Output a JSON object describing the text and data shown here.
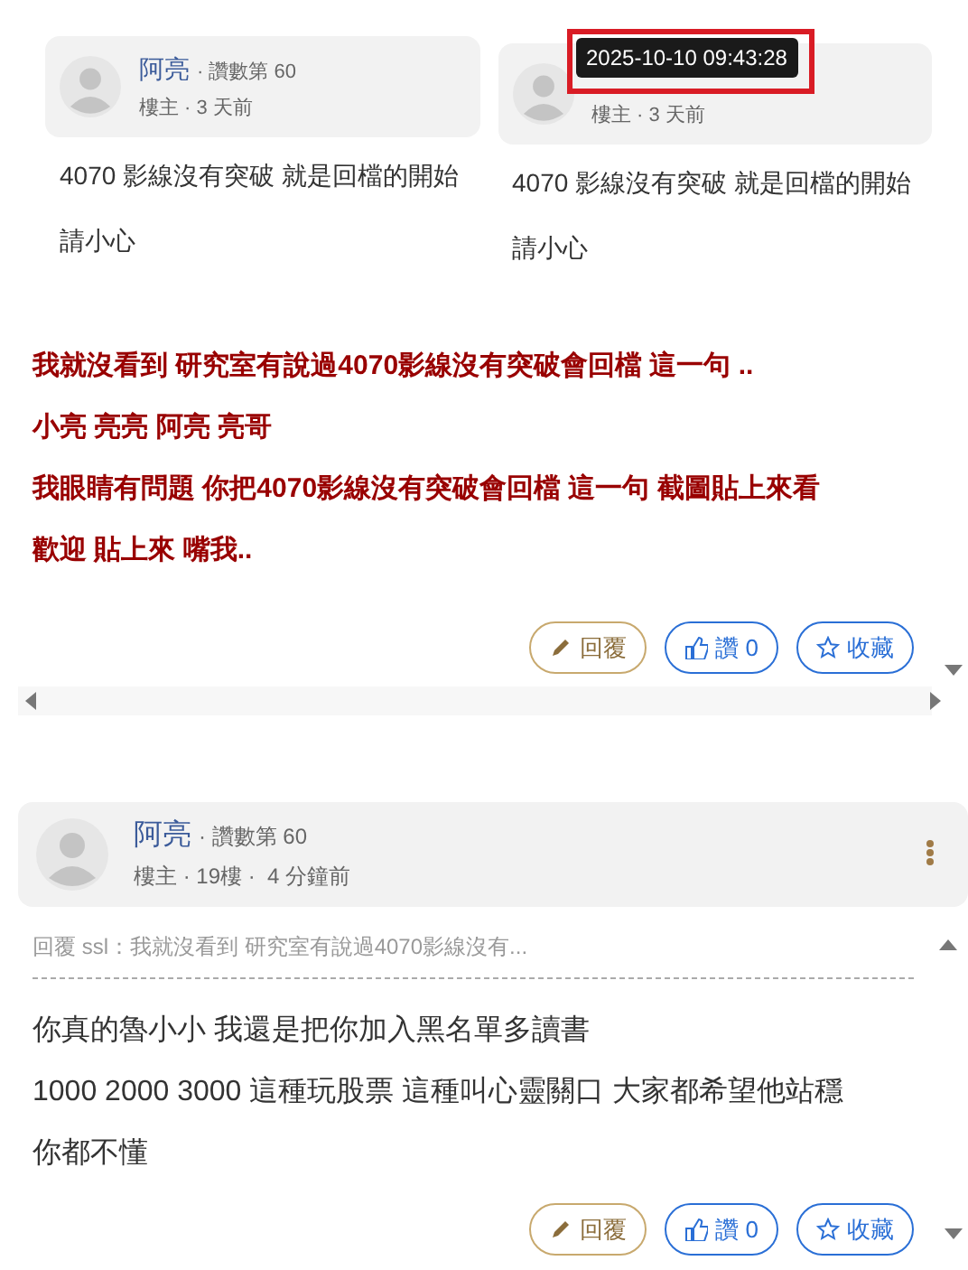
{
  "quoted_post": {
    "screenshot": {
      "cards": [
        {
          "author": "阿亮",
          "rank": "· 讚數第 60",
          "meta": "樓主 · 3 天前",
          "body": [
            "4070 影線沒有突破 就是回檔的開始",
            "請小心"
          ]
        },
        {
          "meta": "樓主 · 3 天前",
          "body": [
            "4070 影線沒有突破 就是回檔的開始",
            "請小心"
          ],
          "tooltip": "2025-10-10 09:43:28"
        }
      ]
    },
    "lines": [
      "我就沒看到 研究室有說過**4070**影線沒有突破會回檔 這一句 ..",
      "小亮 亮亮 阿亮 亮哥",
      "我眼睛有問題 你把**4070**影線沒有突破會回檔 這一句 截圖貼上來看",
      "歡迎 貼上來 嘴我.."
    ],
    "actions": [
      {
        "kind": "reply",
        "label": "回覆"
      },
      {
        "kind": "like",
        "label": "讚 0"
      },
      {
        "kind": "favorite",
        "label": "收藏"
      }
    ]
  },
  "post": {
    "author": "阿亮",
    "rank": "· 讚數第 60",
    "meta": "樓主 · 19樓 ·  4 分鐘前",
    "reply_to": "回覆 ssl：我就沒看到 研究室有說過4070影線沒有...",
    "lines": [
      "你真的魯小小 我還是把你加入黑名單多讀書",
      "1000 2000 3000 這種玩股票 這種叫心靈關口 大家都希望他站穩",
      "你都不懂"
    ],
    "actions": [
      {
        "kind": "reply",
        "label": "回覆"
      },
      {
        "kind": "like",
        "label": "讚 0"
      },
      {
        "kind": "favorite",
        "label": "收藏"
      }
    ]
  }
}
